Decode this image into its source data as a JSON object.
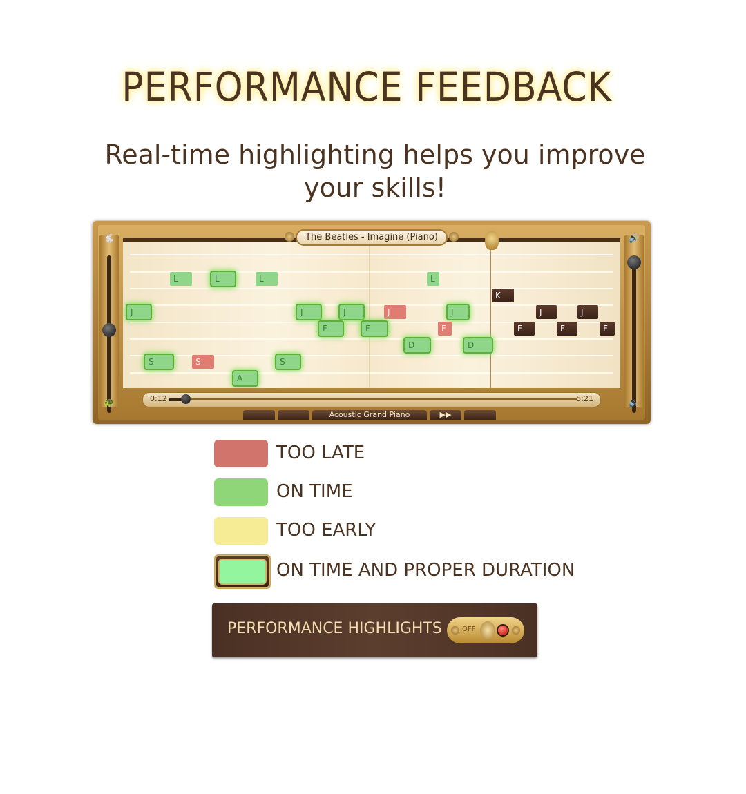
{
  "page": {
    "title": "PERFORMANCE FEEDBACK",
    "subtitle": "Real-time highlighting helps you improve your skills!"
  },
  "player": {
    "song_title": "The Beatles - Imagine (Piano)",
    "elapsed": "0:12",
    "duration": "5:21",
    "progress_fraction": 0.04,
    "bottom_buttons": [
      "",
      "",
      "Acoustic Grand Piano",
      "▶▶",
      ""
    ],
    "notes": [
      {
        "key": "L",
        "status": "green"
      },
      {
        "key": "L",
        "status": "proper"
      },
      {
        "key": "L",
        "status": "green"
      },
      {
        "key": "L",
        "status": "green"
      },
      {
        "key": "K",
        "status": "upcoming"
      },
      {
        "key": "J",
        "status": "proper"
      },
      {
        "key": "J",
        "status": "proper"
      },
      {
        "key": "J",
        "status": "proper"
      },
      {
        "key": "J",
        "status": "red"
      },
      {
        "key": "J",
        "status": "proper"
      },
      {
        "key": "J",
        "status": "upcoming"
      },
      {
        "key": "J",
        "status": "upcoming"
      },
      {
        "key": "F",
        "status": "proper"
      },
      {
        "key": "F",
        "status": "proper"
      },
      {
        "key": "F",
        "status": "red"
      },
      {
        "key": "F",
        "status": "upcoming"
      },
      {
        "key": "F",
        "status": "upcoming"
      },
      {
        "key": "F",
        "status": "upcoming"
      },
      {
        "key": "D",
        "status": "proper"
      },
      {
        "key": "D",
        "status": "proper"
      },
      {
        "key": "S",
        "status": "proper"
      },
      {
        "key": "S",
        "status": "red"
      },
      {
        "key": "S",
        "status": "proper"
      },
      {
        "key": "A",
        "status": "proper"
      }
    ]
  },
  "legend": [
    {
      "label": "TOO LATE",
      "color": "#d1746b"
    },
    {
      "label": "ON TIME",
      "color": "#8fd678"
    },
    {
      "label": "TOO EARLY",
      "color": "#f6ec95"
    },
    {
      "label": "ON TIME AND PROPER DURATION",
      "color": "#93f59d"
    }
  ],
  "highlights": {
    "label": "PERFORMANCE HIGHLIGHTS",
    "toggle_off_label": "OFF",
    "toggle_state": "off"
  }
}
